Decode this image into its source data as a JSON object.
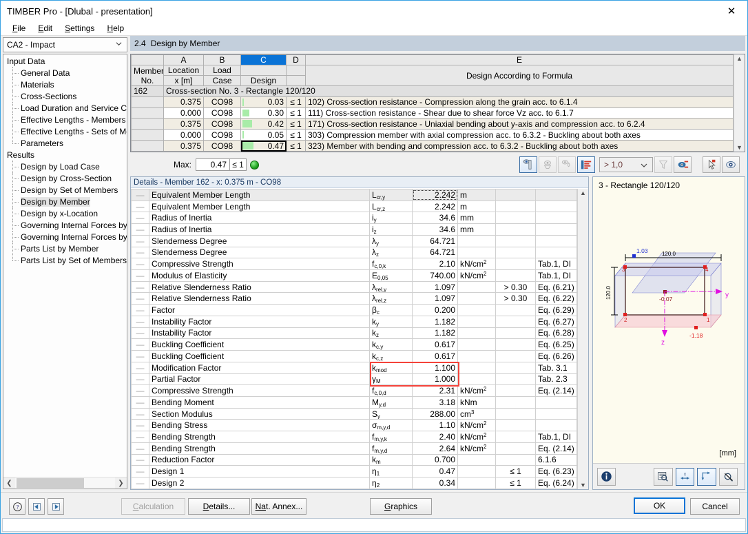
{
  "window": {
    "title": "TIMBER Pro - [Dlubal - presentation]",
    "close_label": "✕"
  },
  "menu": [
    {
      "label": "File",
      "accel": "F"
    },
    {
      "label": "Edit",
      "accel": "E"
    },
    {
      "label": "Settings",
      "accel": "S"
    },
    {
      "label": "Help",
      "accel": "H"
    }
  ],
  "sidebar": {
    "combo_value": "CA2 - Impact",
    "groups": [
      {
        "label": "Input Data",
        "items": [
          "General Data",
          "Materials",
          "Cross-Sections",
          "Load Duration and Service Class",
          "Effective Lengths - Members",
          "Effective Lengths - Sets of Members",
          "Parameters"
        ]
      },
      {
        "label": "Results",
        "items": [
          "Design by Load Case",
          "Design by Cross-Section",
          "Design by Set of Members",
          "Design by Member",
          "Design by x-Location",
          "Governing Internal Forces by Member",
          "Governing Internal Forces by Set of Members",
          "Parts List by Member",
          "Parts List by Set of Members"
        ]
      }
    ],
    "selected_item": "Design by Member"
  },
  "section": {
    "number": "2.4",
    "title": "Design by Member"
  },
  "results_table": {
    "col_letters": [
      "",
      "A",
      "B",
      "C",
      "D",
      "E"
    ],
    "selected_col_letter": "C",
    "headers": {
      "member": [
        "Member",
        "No."
      ],
      "a": [
        "Location",
        "x [m]"
      ],
      "b": [
        "Load",
        "Case"
      ],
      "c": [
        "",
        "Design"
      ],
      "d": [
        "",
        ""
      ],
      "e": "Design According to Formula"
    },
    "member_no": "162",
    "cross_section_row": "Cross-section No.  3 - Rectangle 120/120",
    "rows": [
      {
        "location": "0.375",
        "load_case": "CO98",
        "design": "0.03",
        "bar_pct": 3,
        "cond": "≤ 1",
        "formula": "102) Cross-section resistance - Compression along the grain acc. to 6.1.4",
        "selected": false
      },
      {
        "location": "0.000",
        "load_case": "CO98",
        "design": "0.30",
        "bar_pct": 30,
        "cond": "≤ 1",
        "formula": "111) Cross-section resistance - Shear due to shear force Vz acc. to 6.1.7",
        "selected": false
      },
      {
        "location": "0.375",
        "load_case": "CO98",
        "design": "0.42",
        "bar_pct": 42,
        "cond": "≤ 1",
        "formula": "171) Cross-section resistance - Uniaxial bending about y-axis and compression acc. to 6.2.4",
        "selected": false
      },
      {
        "location": "0.000",
        "load_case": "CO98",
        "design": "0.05",
        "bar_pct": 5,
        "cond": "≤ 1",
        "formula": "303) Compression member with axial compression acc. to 6.3.2 - Buckling about both axes",
        "selected": false
      },
      {
        "location": "0.375",
        "load_case": "CO98",
        "design": "0.47",
        "bar_pct": 47,
        "cond": "≤ 1",
        "formula": "323) Member with bending and compression acc. to 6.3.2 - Buckling about both axes",
        "selected": true
      }
    ]
  },
  "maxbar": {
    "label": "Max:",
    "value": "0.47",
    "condition": "≤ 1",
    "filter_value": "> 1,0",
    "buttons": [
      {
        "name": "color-bars-button",
        "active": true
      },
      {
        "name": "result-diagram-button",
        "active": false
      },
      {
        "name": "details-mode-button",
        "active": false
      },
      {
        "name": "table-view-button",
        "active": true
      },
      {
        "name": "filter-button",
        "active": false
      },
      {
        "name": "color-spectrum-button",
        "active": false
      },
      {
        "name": "pick-member-button",
        "active": false
      },
      {
        "name": "view-mode-button",
        "active": false
      }
    ]
  },
  "details": {
    "title": "Details - Member 162 - x: 0.375 m - CO98",
    "rows": [
      {
        "desc": "Equivalent Member Length",
        "sym_base": "L",
        "sym_sub": "cr,y",
        "value": "2.242",
        "unit": "m",
        "unit_sup": "",
        "cond": "",
        "ref": "",
        "focus": true
      },
      {
        "desc": "Equivalent Member Length",
        "sym_base": "L",
        "sym_sub": "cr,z",
        "value": "2.242",
        "unit": "m",
        "unit_sup": "",
        "cond": "",
        "ref": ""
      },
      {
        "desc": "Radius of Inertia",
        "sym_base": "i",
        "sym_sub": "y",
        "value": "34.6",
        "unit": "mm",
        "unit_sup": "",
        "cond": "",
        "ref": ""
      },
      {
        "desc": "Radius of Inertia",
        "sym_base": "i",
        "sym_sub": "z",
        "value": "34.6",
        "unit": "mm",
        "unit_sup": "",
        "cond": "",
        "ref": ""
      },
      {
        "desc": "Slenderness Degree",
        "sym_base": "λ",
        "sym_sub": "y",
        "value": "64.721",
        "unit": "",
        "unit_sup": "",
        "cond": "",
        "ref": ""
      },
      {
        "desc": "Slenderness Degree",
        "sym_base": "λ",
        "sym_sub": "z",
        "value": "64.721",
        "unit": "",
        "unit_sup": "",
        "cond": "",
        "ref": ""
      },
      {
        "desc": "Compressive Strength",
        "sym_base": "f",
        "sym_sub": "c,0,k",
        "value": "2.10",
        "unit": "kN/cm",
        "unit_sup": "2",
        "cond": "",
        "ref": "Tab.1, DI"
      },
      {
        "desc": "Modulus of Elasticity",
        "sym_base": "E",
        "sym_sub": "0,05",
        "value": "740.00",
        "unit": "kN/cm",
        "unit_sup": "2",
        "cond": "",
        "ref": "Tab.1, DI"
      },
      {
        "desc": "Relative Slenderness Ratio",
        "sym_base": "λ",
        "sym_sub": "rel,y",
        "value": "1.097",
        "unit": "",
        "unit_sup": "",
        "cond": "> 0.30",
        "ref": "Eq. (6.21)"
      },
      {
        "desc": "Relative Slenderness Ratio",
        "sym_base": "λ",
        "sym_sub": "rel,z",
        "value": "1.097",
        "unit": "",
        "unit_sup": "",
        "cond": "> 0.30",
        "ref": "Eq. (6.22)"
      },
      {
        "desc": "Factor",
        "sym_base": "β",
        "sym_sub": "c",
        "value": "0.200",
        "unit": "",
        "unit_sup": "",
        "cond": "",
        "ref": "Eq. (6.29)"
      },
      {
        "desc": "Instability Factor",
        "sym_base": "k",
        "sym_sub": "y",
        "value": "1.182",
        "unit": "",
        "unit_sup": "",
        "cond": "",
        "ref": "Eq. (6.27)"
      },
      {
        "desc": "Instability Factor",
        "sym_base": "k",
        "sym_sub": "z",
        "value": "1.182",
        "unit": "",
        "unit_sup": "",
        "cond": "",
        "ref": "Eq. (6.28)"
      },
      {
        "desc": "Buckling Coefficient",
        "sym_base": "k",
        "sym_sub": "c,y",
        "value": "0.617",
        "unit": "",
        "unit_sup": "",
        "cond": "",
        "ref": "Eq. (6.25)"
      },
      {
        "desc": "Buckling Coefficient",
        "sym_base": "k",
        "sym_sub": "c,z",
        "value": "0.617",
        "unit": "",
        "unit_sup": "",
        "cond": "",
        "ref": "Eq. (6.26)"
      },
      {
        "desc": "Modification Factor",
        "sym_base": "k",
        "sym_sub": "mod",
        "value": "1.100",
        "unit": "",
        "unit_sup": "",
        "cond": "",
        "ref": "Tab. 3.1",
        "highlight": true
      },
      {
        "desc": "Partial Factor",
        "sym_base": "γ",
        "sym_sub": "M",
        "value": "1.000",
        "unit": "",
        "unit_sup": "",
        "cond": "",
        "ref": "Tab. 2.3",
        "highlight": true
      },
      {
        "desc": "Compressive Strength",
        "sym_base": "f",
        "sym_sub": "c,0,d",
        "value": "2.31",
        "unit": "kN/cm",
        "unit_sup": "2",
        "cond": "",
        "ref": "Eq. (2.14)"
      },
      {
        "desc": "Bending Moment",
        "sym_base": "M",
        "sym_sub": "y,d",
        "value": "3.18",
        "unit": "kNm",
        "unit_sup": "",
        "cond": "",
        "ref": ""
      },
      {
        "desc": "Section Modulus",
        "sym_base": "S",
        "sym_sub": "y",
        "value": "288.00",
        "unit": "cm",
        "unit_sup": "3",
        "cond": "",
        "ref": ""
      },
      {
        "desc": "Bending Stress",
        "sym_base": "σ",
        "sym_sub": "m,y,d",
        "value": "1.10",
        "unit": "kN/cm",
        "unit_sup": "2",
        "cond": "",
        "ref": ""
      },
      {
        "desc": "Bending Strength",
        "sym_base": "f",
        "sym_sub": "m,y,k",
        "value": "2.40",
        "unit": "kN/cm",
        "unit_sup": "2",
        "cond": "",
        "ref": "Tab.1, DI"
      },
      {
        "desc": "Bending Strength",
        "sym_base": "f",
        "sym_sub": "m,y,d",
        "value": "2.64",
        "unit": "kN/cm",
        "unit_sup": "2",
        "cond": "",
        "ref": "Eq. (2.14)"
      },
      {
        "desc": "Reduction Factor",
        "sym_base": "k",
        "sym_sub": "m",
        "value": "0.700",
        "unit": "",
        "unit_sup": "",
        "cond": "",
        "ref": "6.1.6"
      },
      {
        "desc": "Design 1",
        "sym_base": "η",
        "sym_sub": "1",
        "value": "0.47",
        "unit": "",
        "unit_sup": "",
        "cond": "≤ 1",
        "ref": "Eq. (6.23)"
      },
      {
        "desc": "Design 2",
        "sym_base": "η",
        "sym_sub": "2",
        "value": "0.34",
        "unit": "",
        "unit_sup": "",
        "cond": "≤ 1",
        "ref": "Eq. (6.24)"
      }
    ]
  },
  "graphics": {
    "title": "3 - Rectangle 120/120",
    "unit": "[mm]",
    "dim_top": "120.0",
    "dim_left": "120.0",
    "stress_top": "1.03",
    "stress_center": "-0.07",
    "stress_bottom": "-1.18",
    "node_labels": [
      "1",
      "2",
      "3",
      "4"
    ],
    "axis_y": "y",
    "axis_z": "z",
    "toolbar": [
      {
        "name": "info-button",
        "active": false
      },
      {
        "name": "zoom-table-button",
        "active": false
      },
      {
        "name": "dimension-x-button",
        "active": true
      },
      {
        "name": "dimension-corner-button",
        "active": true
      },
      {
        "name": "hide-annotations-button",
        "active": false
      }
    ]
  },
  "footer": {
    "help_icon": "?",
    "prev_label": "prev-chapter-icon",
    "next_label": "next-chapter-icon",
    "calculation": "Calculation",
    "calculation_accel": "C",
    "details": "Details...",
    "details_accel": "D",
    "nat_annex": "Nat. Annex...",
    "nat_annex_accel": "Na",
    "graphics": "Graphics",
    "graphics_accel": "G",
    "ok": "OK",
    "cancel": "Cancel"
  },
  "colors": {
    "accent": "#0a73d6",
    "section_bar": "#c3cfdc",
    "bar_green": "#a8eca8",
    "highlight_red": "#f4433a",
    "titlebar_border": "#3aa3e3"
  }
}
